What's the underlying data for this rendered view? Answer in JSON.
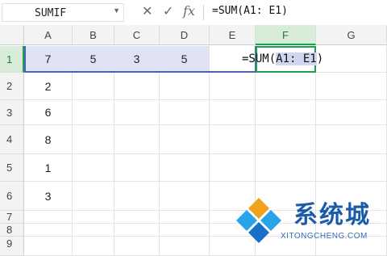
{
  "formula_bar": {
    "name_box": "SUMIF",
    "cancel_icon": "✕",
    "confirm_icon": "✓",
    "fx_icon": "fx",
    "formula": "=SUM(A1: E1)"
  },
  "columns": [
    "A",
    "B",
    "C",
    "D",
    "E",
    "F",
    "G"
  ],
  "selected_column": "F",
  "rows": [
    "1",
    "2",
    "3",
    "4",
    "5",
    "6",
    "7",
    "8",
    "9"
  ],
  "selected_row": "1",
  "cells": {
    "A1": "7",
    "B1": "5",
    "C1": "3",
    "D1": "5",
    "A2": "2",
    "A3": "6",
    "A4": "8",
    "A5": "1",
    "A6": "3"
  },
  "f1_editing": {
    "prefix": "=SUM(",
    "reference": "A1: E1",
    "suffix": ")"
  },
  "watermark": {
    "text": "系统城",
    "url": "XITONGCHENG.COM"
  },
  "colors": {
    "active_green": "#1f9f4b",
    "reference_blue": "#4a63b8",
    "reference_fill": "#dfe3f5",
    "watermark_blue": "#1a5ca8"
  }
}
